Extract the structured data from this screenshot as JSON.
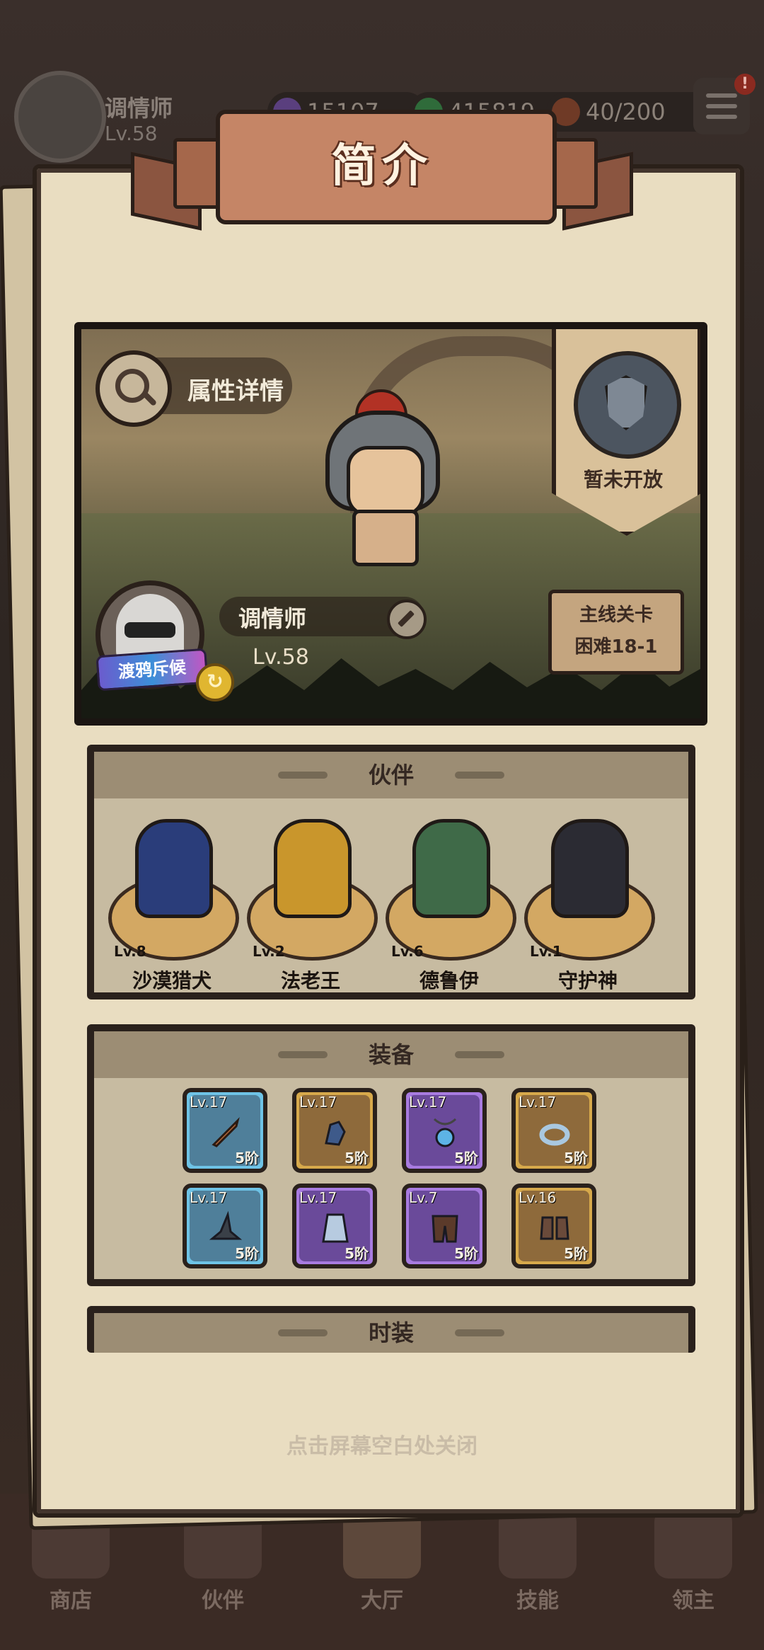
{
  "topbar": {
    "player_name": "调情师",
    "player_level": "Lv.58",
    "title_text": "渡鸦斥候",
    "resources": [
      {
        "icon": "purple-gem-icon",
        "value": "15107",
        "color": "#7a4fb0"
      },
      {
        "icon": "green-gem-icon",
        "value": "415819",
        "color": "#3f8f4d"
      },
      {
        "icon": "meat-stamina-icon",
        "value": "40/200",
        "color": "#9b4e32"
      }
    ],
    "menu_badge": "!"
  },
  "panel": {
    "title": "简介",
    "close_hint": "点击屏幕空白处关闭"
  },
  "hero_card": {
    "attr_detail_label": "属性详情",
    "locked_label": "暂未开放",
    "player_name": "调情师",
    "player_level": "Lv.58",
    "title_badge": "渡鸦斥候",
    "stage_label": "主线关卡",
    "stage_value": "困难18-1"
  },
  "partners": {
    "header": "伙伴",
    "items": [
      {
        "name": "沙漠猎犬",
        "level": "Lv.8",
        "color": "#2a3d7a"
      },
      {
        "name": "法老王",
        "level": "Lv.2",
        "color": "#c9962c"
      },
      {
        "name": "德鲁伊",
        "level": "Lv.6",
        "color": "#3f6a48"
      },
      {
        "name": "守护神",
        "level": "Lv.1",
        "color": "#2b2b33"
      }
    ]
  },
  "equipment": {
    "header": "装备",
    "items": [
      {
        "level": "Lv.17",
        "tier": "5阶",
        "icon": "sword-icon",
        "rarity": "blue"
      },
      {
        "level": "Lv.17",
        "tier": "5阶",
        "icon": "gauntlet-icon",
        "rarity": "gold"
      },
      {
        "level": "Lv.17",
        "tier": "5阶",
        "icon": "amulet-icon",
        "rarity": "purple"
      },
      {
        "level": "Lv.17",
        "tier": "5阶",
        "icon": "ring-icon",
        "rarity": "gold"
      },
      {
        "level": "Lv.17",
        "tier": "5阶",
        "icon": "wizard-hat-icon",
        "rarity": "blue"
      },
      {
        "level": "Lv.17",
        "tier": "5阶",
        "icon": "robe-icon",
        "rarity": "purple"
      },
      {
        "level": "Lv.7",
        "tier": "5阶",
        "icon": "belt-pants-icon",
        "rarity": "purple"
      },
      {
        "level": "Lv.16",
        "tier": "5阶",
        "icon": "boots-icon",
        "rarity": "gold"
      }
    ]
  },
  "costume": {
    "header": "时装"
  },
  "bottom_nav": {
    "items": [
      {
        "label": "商店"
      },
      {
        "label": "伙伴"
      },
      {
        "label": "大厅"
      },
      {
        "label": "技能"
      },
      {
        "label": "领主"
      }
    ]
  },
  "colors": {
    "rarity_blue": "#4f7f9a",
    "rarity_gold": "#8e6a3b",
    "rarity_purple": "#6a4a9a",
    "frame_blue": "#6ec3e6",
    "frame_gold": "#d7a94b",
    "frame_purple": "#a87be0"
  }
}
